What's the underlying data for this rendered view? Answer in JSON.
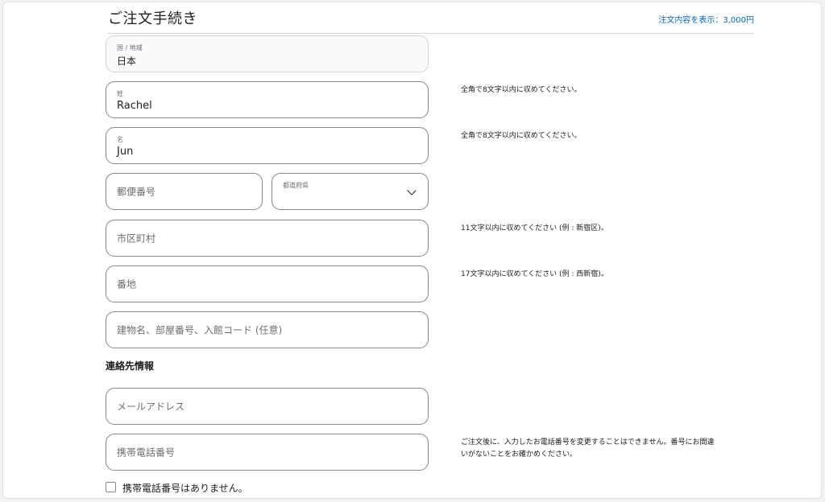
{
  "header": {
    "title": "ご注文手続き",
    "order_summary_link": "注文内容を表示：3,000円"
  },
  "fields": {
    "country": {
      "label": "国 / 地域",
      "value": "日本"
    },
    "last_name": {
      "label": "姓",
      "value": "Rachel",
      "note": "全角で8文字以内に収めてください。"
    },
    "first_name": {
      "label": "名",
      "value": "Jun",
      "note": "全角で8文字以内に収めてください。"
    },
    "postal_code": {
      "placeholder": "郵便番号"
    },
    "prefecture": {
      "label": "都道府県",
      "value": ""
    },
    "city": {
      "placeholder": "市区町村",
      "note": "11文字以内に収めてください (例 : 新宿区)。"
    },
    "street": {
      "placeholder": "番地",
      "note": "17文字以内に収めてください (例 : 西新宿)。"
    },
    "building": {
      "placeholder": "建物名、部屋番号、入館コード (任意)"
    }
  },
  "contact": {
    "heading": "連絡先情報",
    "email": {
      "placeholder": "メールアドレス"
    },
    "phone": {
      "placeholder": "携帯電話番号",
      "note": "ご注文後に、入力したお電話番号を変更することはできません。番号にお間違いがないことをお確かめください。"
    },
    "no_phone_label": "携帯電話番号はありません。",
    "no_phone_checked": false
  },
  "colors": {
    "link": "#0066cc",
    "border": "#86868b",
    "text": "#1d1d1f"
  }
}
